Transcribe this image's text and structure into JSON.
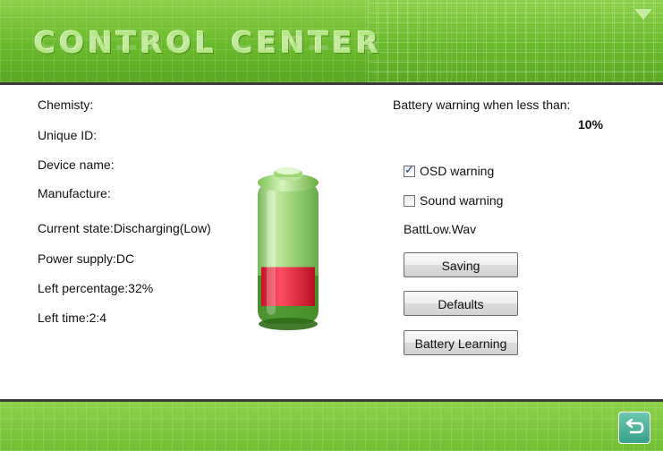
{
  "header": {
    "title": "CONTROL CENTER",
    "accent_color": "#6ab92c",
    "menu_icon": "triangle-down-icon"
  },
  "info": {
    "chemistry": "Chemisty:",
    "unique_id": "Unique ID:",
    "device_name": "Device name:",
    "manufacture": "Manufacture:",
    "current_state": "Current state:Discharging(Low)",
    "power_supply": "Power supply:DC",
    "left_percentage": "Left percentage:32%",
    "left_time": "Left time:2:4"
  },
  "battery": {
    "icon": "battery-icon",
    "level_percent": 32,
    "fill_color": "#e8283c"
  },
  "settings": {
    "warning_label": "Battery warning when less than:",
    "warning_value": "10%",
    "osd_warning": {
      "label": "OSD warning",
      "checked": true
    },
    "sound_warning": {
      "label": "Sound warning",
      "checked": false
    },
    "sound_file": "BattLow.Wav"
  },
  "buttons": {
    "saving": "Saving",
    "defaults": "Defaults",
    "battery_learning": "Battery Learning"
  },
  "footer": {
    "back_icon": "return-arrow-icon"
  }
}
